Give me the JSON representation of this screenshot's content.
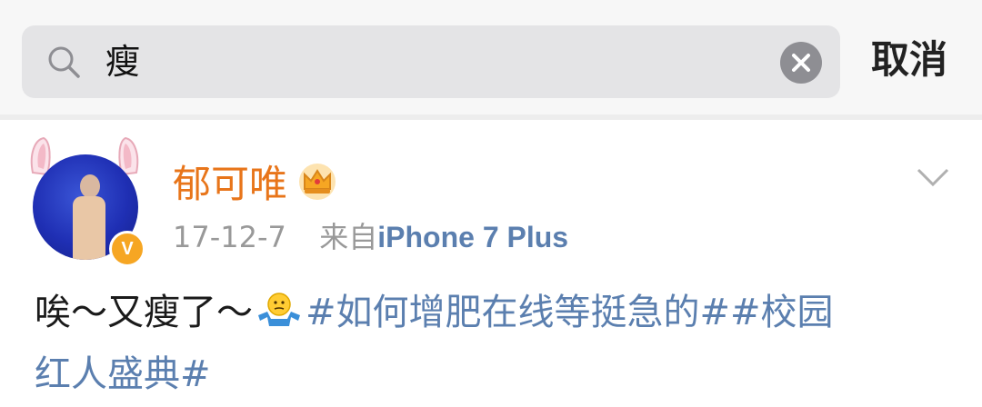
{
  "search": {
    "query": "瘦",
    "cancel_label": "取消"
  },
  "post": {
    "username": "郁可唯",
    "verified_badge": "V",
    "date": "17-12-7",
    "source_prefix": "来自",
    "device": "iPhone 7 Plus",
    "text_plain": "唉～又瘦了～",
    "emoji": "shrug-emoji",
    "topic_1": "#如何增肥在线等挺急的#",
    "topic_2_part1": "#校园",
    "topic_2_part2": "红人盛典#"
  },
  "colors": {
    "username": "#e8751a",
    "topic": "#5b7faf",
    "badge": "#f6a623"
  }
}
